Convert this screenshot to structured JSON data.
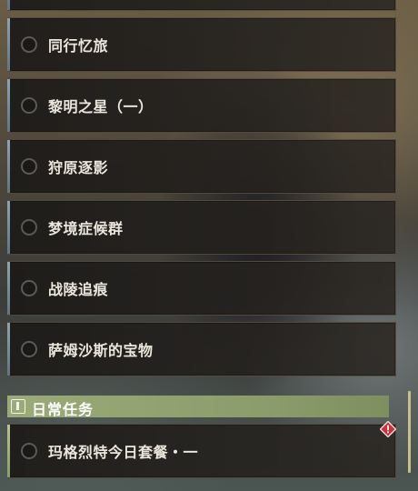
{
  "quests": [
    {
      "label": "同行忆旅"
    },
    {
      "label": "黎明之星（一）"
    },
    {
      "label": "狩原逐影"
    },
    {
      "label": "梦境症候群"
    },
    {
      "label": "战陵追痕"
    },
    {
      "label": "萨姆沙斯的宝物"
    }
  ],
  "daily_section": {
    "title": "日常任务",
    "icon": "exclamation-box-icon",
    "accent": "#9aab78"
  },
  "daily_quests": [
    {
      "label": "玛格烈特今日套餐・一",
      "alert_icon": "warning-diamond-icon",
      "alert_color": "#c8323c"
    }
  ],
  "colors": {
    "card_bg": "#1c1a18",
    "card_border": "#786c56",
    "quest_stripe": "#8fa4ae",
    "text": "#ece7dc"
  }
}
